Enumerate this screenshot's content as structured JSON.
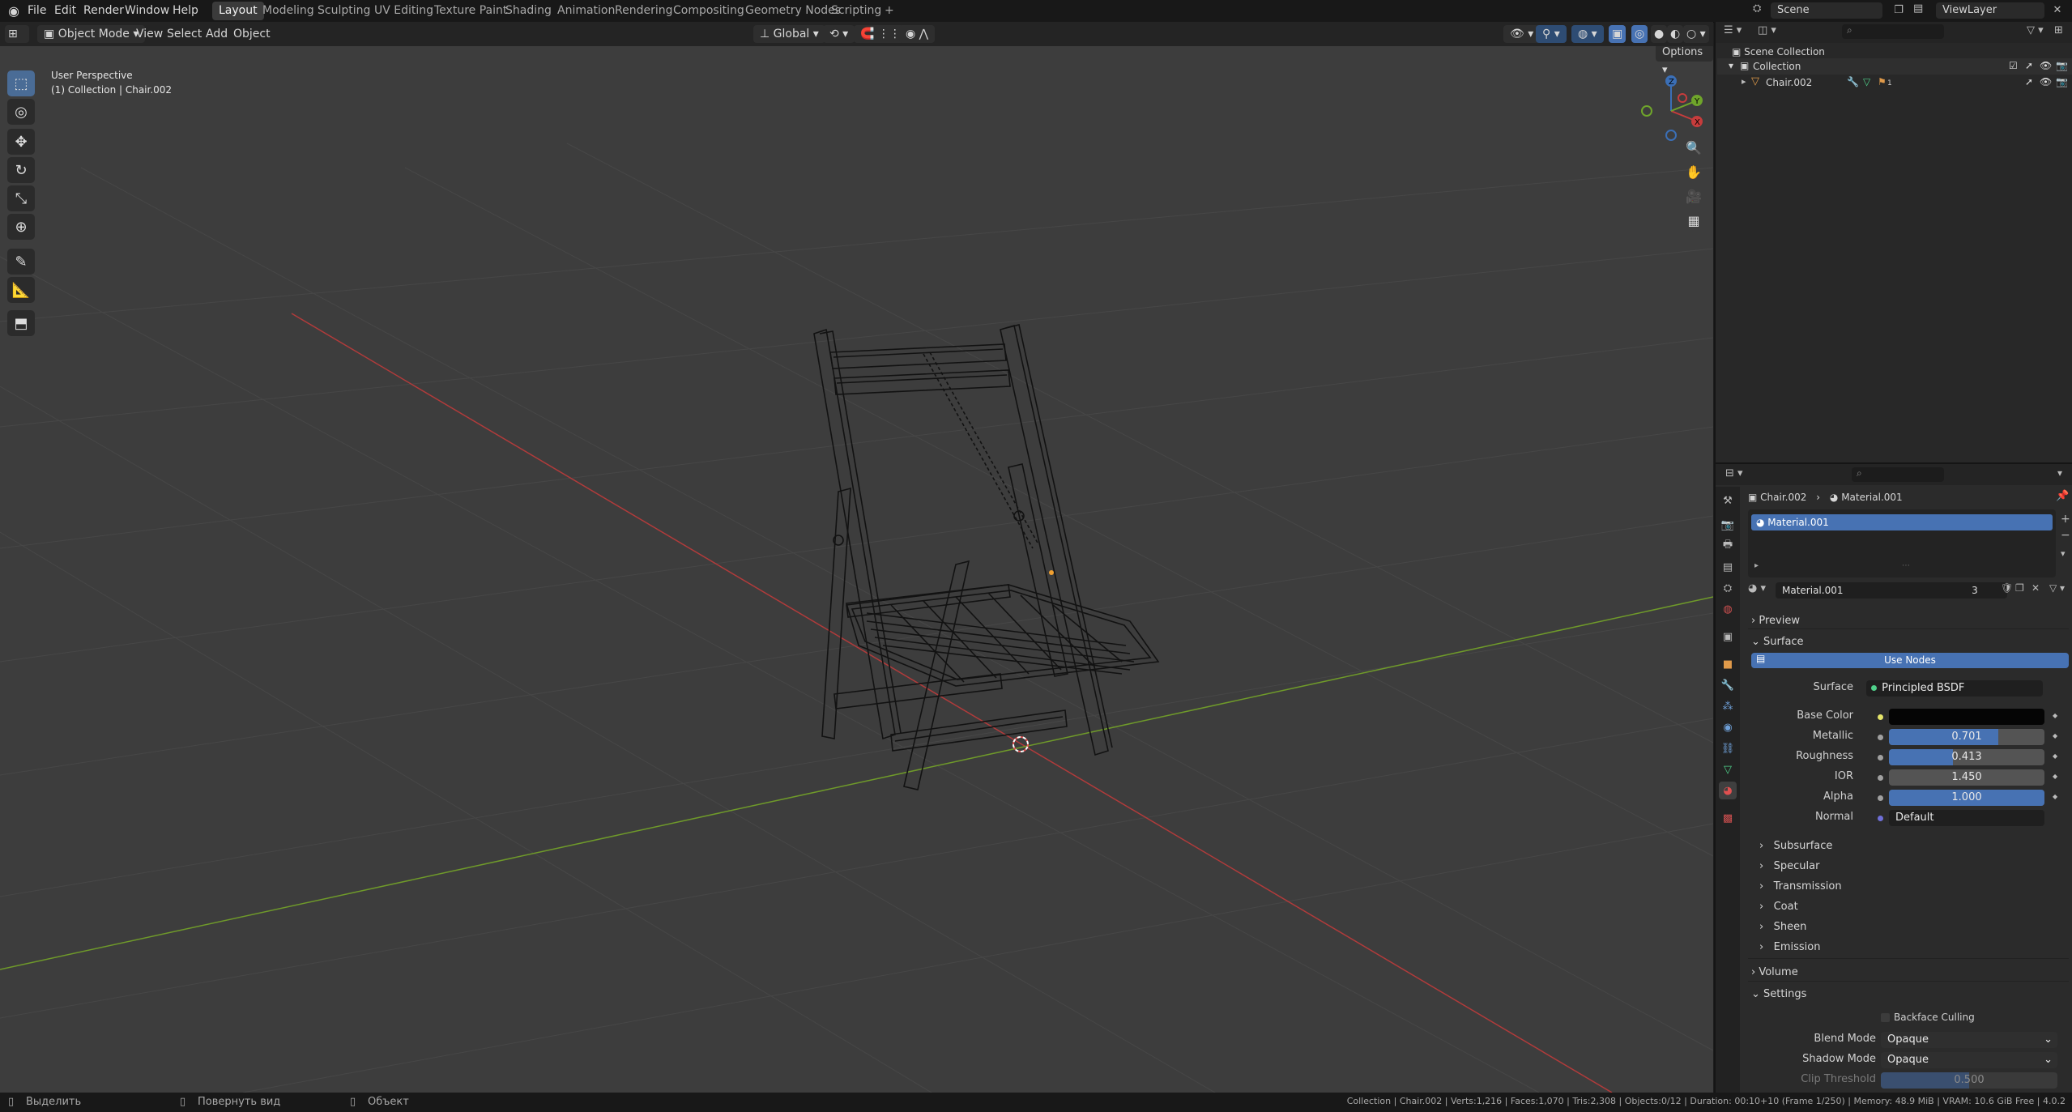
{
  "menu": {
    "items": [
      "File",
      "Edit",
      "Render",
      "Window",
      "Help"
    ],
    "workspaces": [
      "Layout",
      "Modeling",
      "Sculpting",
      "UV Editing",
      "Texture Paint",
      "Shading",
      "Animation",
      "Rendering",
      "Compositing",
      "Geometry Nodes",
      "Scripting"
    ],
    "active_workspace": "Layout",
    "add_tab": "+",
    "scene": "Scene",
    "view_layer": "ViewLayer"
  },
  "viewport_header": {
    "mode": "Object Mode",
    "menus": [
      "View",
      "Select",
      "Add",
      "Object"
    ],
    "transform_orientation": "Global",
    "options": "Options"
  },
  "viewport": {
    "perspective": "User Perspective",
    "object_info": "(1) Collection | Chair.002",
    "gizmo": {
      "x": "X",
      "y": "Y",
      "z": "Z"
    },
    "colors": {
      "background": "#3d3d3d",
      "x_axis": "#c13b3b",
      "y_axis": "#6f9f2a",
      "wire": "#111111"
    }
  },
  "tools": [
    "select-box-icon",
    "cursor-icon",
    "move-icon",
    "rotate-icon",
    "scale-icon",
    "transform-icon",
    "annotate-icon",
    "measure-icon",
    "add-cube-icon"
  ],
  "outliner": {
    "root": "Scene Collection",
    "collection": "Collection",
    "object": "Chair.002",
    "modifier_count": "1"
  },
  "properties": {
    "breadcrumb_object": "Chair.002",
    "breadcrumb_material": "Material.001",
    "slot": "Material.001",
    "material_name": "Material.001",
    "users": "3",
    "panels": {
      "preview": "Preview",
      "surface": "Surface",
      "volume": "Volume",
      "settings": "Settings"
    },
    "use_nodes": "Use Nodes",
    "surface": {
      "surface_label": "Surface",
      "surface_value": "Principled BSDF",
      "base_color_label": "Base Color",
      "base_color": "#050505",
      "metallic_label": "Metallic",
      "metallic": "0.701",
      "metallic_frac": 0.701,
      "roughness_label": "Roughness",
      "roughness": "0.413",
      "roughness_frac": 0.413,
      "ior_label": "IOR",
      "ior": "1.450",
      "alpha_label": "Alpha",
      "alpha": "1.000",
      "alpha_frac": 1.0,
      "normal_label": "Normal",
      "normal": "Default"
    },
    "subpanels": [
      "Subsurface",
      "Specular",
      "Transmission",
      "Coat",
      "Sheen",
      "Emission"
    ],
    "settings": {
      "backface_culling": "Backface Culling",
      "blend_mode_label": "Blend Mode",
      "blend_mode": "Opaque",
      "shadow_mode_label": "Shadow Mode",
      "shadow_mode": "Opaque",
      "clip_threshold_label": "Clip Threshold",
      "clip_threshold": "0.500"
    }
  },
  "statusbar": {
    "select": "Выделить",
    "rotate_view": "Повернуть вид",
    "object": "Объект",
    "stats": "Collection | Chair.002 | Verts:1,216 | Faces:1,070 | Tris:2,308 | Objects:0/12 | Duration: 00:10+10 (Frame 1/250) | Memory: 48.9 MiB | VRAM: 10.6 GiB Free | 4.0.2"
  }
}
